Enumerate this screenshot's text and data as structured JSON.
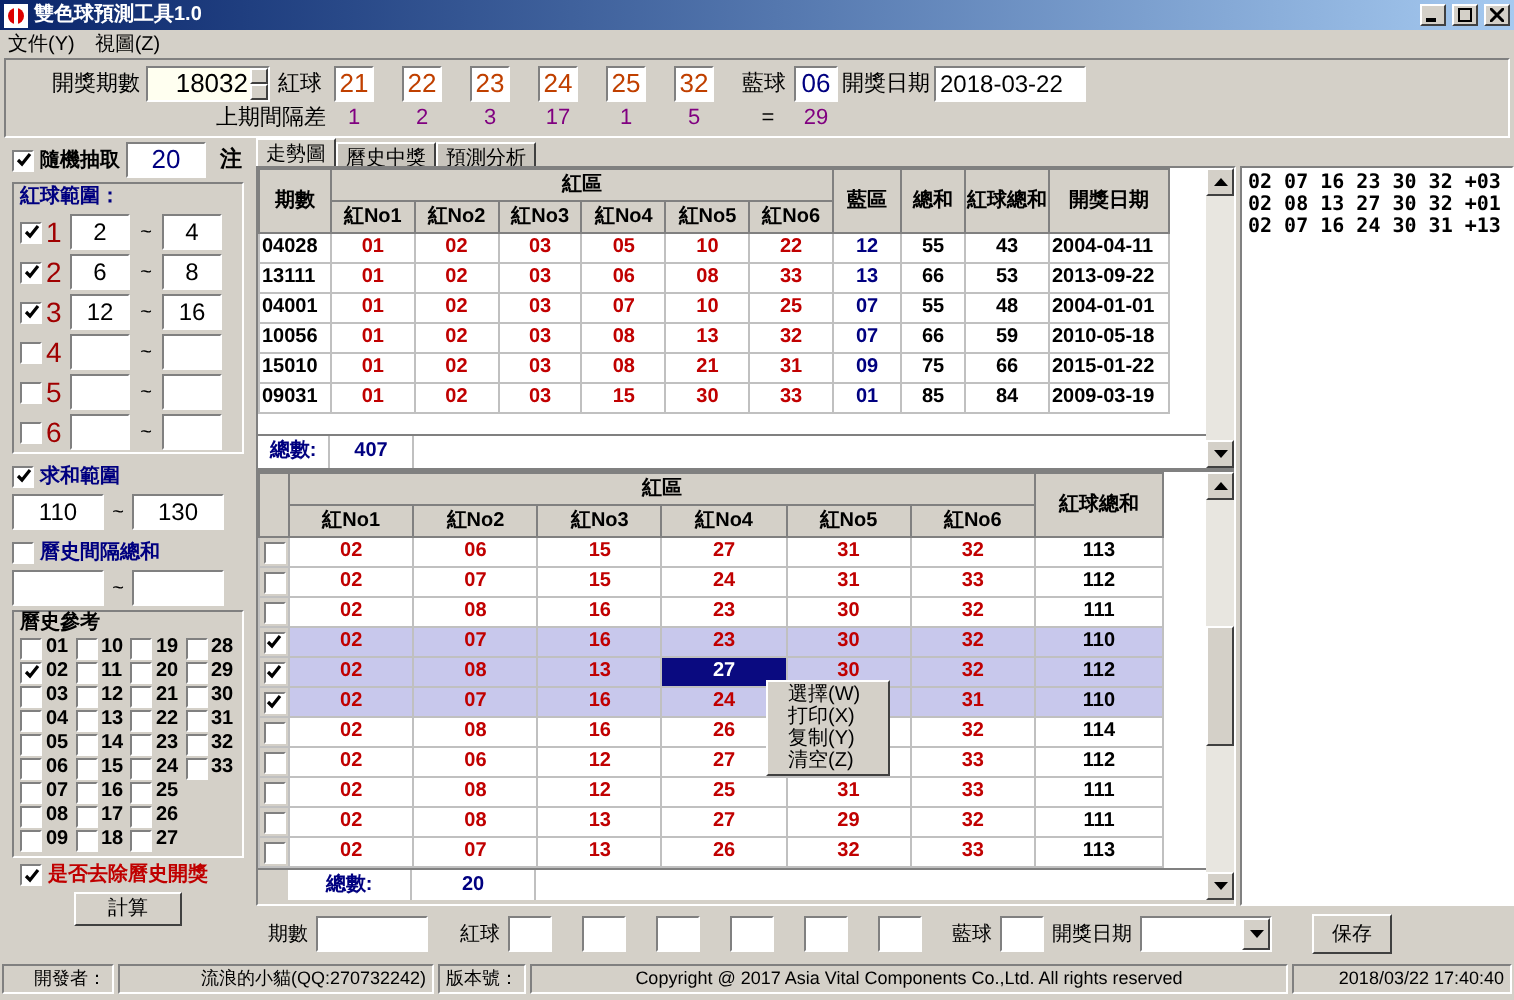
{
  "window": {
    "title": "雙色球預測工具1.0"
  },
  "menu": [
    "文件(Y)",
    "視圖(Z)"
  ],
  "draw": {
    "issue_label": "開獎期數",
    "issue": "18032",
    "red_label": "紅球",
    "reds": [
      "21",
      "22",
      "23",
      "24",
      "25",
      "32"
    ],
    "blue_label": "藍球",
    "blue": "06",
    "date_label": "開獎日期",
    "date": "2018-03-22",
    "gap_label": "上期間隔差",
    "gaps": [
      "1",
      "2",
      "3",
      "17",
      "1",
      "5"
    ],
    "eq": "=",
    "blue_gap": "29"
  },
  "left": {
    "random": {
      "checked": true,
      "label": "隨機抽取",
      "count": "20",
      "unit": "注"
    },
    "red_range": {
      "title": "紅球範圍：",
      "rows": [
        {
          "checked": true,
          "label": "1",
          "from": "2",
          "sep": "~",
          "to": "4"
        },
        {
          "checked": true,
          "label": "2",
          "from": "6",
          "sep": "~",
          "to": "8"
        },
        {
          "checked": true,
          "label": "3",
          "from": "12",
          "sep": "~",
          "to": "16"
        },
        {
          "checked": false,
          "label": "4",
          "sep": "~"
        },
        {
          "checked": false,
          "label": "5",
          "sep": "~"
        },
        {
          "checked": false,
          "label": "6",
          "sep": "~"
        }
      ]
    },
    "sum_range": {
      "checked": true,
      "label": "求和範圍",
      "from": "110",
      "sep": "~",
      "to": "130"
    },
    "hist_gap": {
      "checked": false,
      "label": "曆史間隔總和",
      "sep": "~"
    },
    "history": {
      "title": "曆史參考",
      "items": [
        {
          "label": "01",
          "checked": false
        },
        {
          "label": "02",
          "checked": true
        },
        {
          "label": "03",
          "checked": false
        },
        {
          "label": "04",
          "checked": false
        },
        {
          "label": "05",
          "checked": false
        },
        {
          "label": "06",
          "checked": false
        },
        {
          "label": "07",
          "checked": false
        },
        {
          "label": "08",
          "checked": false
        },
        {
          "label": "09",
          "checked": false
        },
        {
          "label": "10",
          "checked": false
        },
        {
          "label": "11",
          "checked": false
        },
        {
          "label": "12",
          "checked": false
        },
        {
          "label": "13",
          "checked": false
        },
        {
          "label": "14",
          "checked": false
        },
        {
          "label": "15",
          "checked": false
        },
        {
          "label": "16",
          "checked": false
        },
        {
          "label": "17",
          "checked": false
        },
        {
          "label": "18",
          "checked": false
        },
        {
          "label": "19",
          "checked": false
        },
        {
          "label": "20",
          "checked": false
        },
        {
          "label": "21",
          "checked": false
        },
        {
          "label": "22",
          "checked": false
        },
        {
          "label": "23",
          "checked": false
        },
        {
          "label": "24",
          "checked": false
        },
        {
          "label": "25",
          "checked": false
        },
        {
          "label": "26",
          "checked": false
        },
        {
          "label": "27",
          "checked": false
        },
        {
          "label": "28",
          "checked": false
        },
        {
          "label": "29",
          "checked": false
        },
        {
          "label": "30",
          "checked": false
        },
        {
          "label": "31",
          "checked": false
        },
        {
          "label": "32",
          "checked": false
        },
        {
          "label": "33",
          "checked": false
        }
      ]
    },
    "exclude": {
      "checked": true,
      "label": "是否去除曆史開獎"
    },
    "calc_button": "計算"
  },
  "tabs": [
    {
      "label": "走勢圖",
      "selected": true
    },
    {
      "label": "曆史中獎",
      "selected": false
    },
    {
      "label": "預測分析",
      "selected": false
    }
  ],
  "upper_table": {
    "columns": [
      "期數",
      "紅No1",
      "紅No2",
      "紅No3",
      "紅No4",
      "紅No5",
      "紅No6",
      "藍區",
      "總和",
      "紅球總和",
      "開獎日期"
    ],
    "group": "紅區",
    "rows": [
      [
        "04028",
        "01",
        "02",
        "03",
        "05",
        "10",
        "22",
        "12",
        "55",
        "43",
        "2004-04-11"
      ],
      [
        "13111",
        "01",
        "02",
        "03",
        "06",
        "08",
        "33",
        "13",
        "66",
        "53",
        "2013-09-22"
      ],
      [
        "04001",
        "01",
        "02",
        "03",
        "07",
        "10",
        "25",
        "07",
        "55",
        "48",
        "2004-01-01"
      ],
      [
        "10056",
        "01",
        "02",
        "03",
        "08",
        "13",
        "32",
        "07",
        "66",
        "59",
        "2010-05-18"
      ],
      [
        "15010",
        "01",
        "02",
        "03",
        "08",
        "21",
        "31",
        "09",
        "75",
        "66",
        "2015-01-22"
      ],
      [
        "09031",
        "01",
        "02",
        "03",
        "15",
        "30",
        "33",
        "01",
        "85",
        "84",
        "2009-03-19"
      ]
    ],
    "total_label": "總數:",
    "total": "407"
  },
  "lower_table": {
    "group": "紅區",
    "columns": [
      "紅No1",
      "紅No2",
      "紅No3",
      "紅No4",
      "紅No5",
      "紅No6"
    ],
    "sum_column": "紅球總和",
    "rows": [
      {
        "checked": false,
        "selected": false,
        "cells": [
          {
            "value": "02",
            "focused": false
          },
          {
            "value": "06",
            "focused": false
          },
          {
            "value": "15",
            "focused": false
          },
          {
            "value": "27",
            "focused": false
          },
          {
            "value": "31",
            "focused": false
          },
          {
            "value": "32",
            "focused": false
          }
        ],
        "sum": "113"
      },
      {
        "checked": false,
        "selected": false,
        "cells": [
          {
            "value": "02",
            "focused": false
          },
          {
            "value": "07",
            "focused": false
          },
          {
            "value": "15",
            "focused": false
          },
          {
            "value": "24",
            "focused": false
          },
          {
            "value": "31",
            "focused": false
          },
          {
            "value": "33",
            "focused": false
          }
        ],
        "sum": "112"
      },
      {
        "checked": false,
        "selected": false,
        "cells": [
          {
            "value": "02",
            "focused": false
          },
          {
            "value": "08",
            "focused": false
          },
          {
            "value": "16",
            "focused": false
          },
          {
            "value": "23",
            "focused": false
          },
          {
            "value": "30",
            "focused": false
          },
          {
            "value": "32",
            "focused": false
          }
        ],
        "sum": "111"
      },
      {
        "checked": true,
        "selected": true,
        "cells": [
          {
            "value": "02",
            "focused": false
          },
          {
            "value": "07",
            "focused": false
          },
          {
            "value": "16",
            "focused": false
          },
          {
            "value": "23",
            "focused": false
          },
          {
            "value": "30",
            "focused": false
          },
          {
            "value": "32",
            "focused": false
          }
        ],
        "sum": "110"
      },
      {
        "checked": true,
        "selected": true,
        "cells": [
          {
            "value": "02",
            "focused": false
          },
          {
            "value": "08",
            "focused": false
          },
          {
            "value": "13",
            "focused": false
          },
          {
            "value": "27",
            "focused": true
          },
          {
            "value": "30",
            "focused": false
          },
          {
            "value": "32",
            "focused": false
          }
        ],
        "sum": "112"
      },
      {
        "checked": true,
        "selected": true,
        "cells": [
          {
            "value": "02",
            "focused": false
          },
          {
            "value": "07",
            "focused": false
          },
          {
            "value": "16",
            "focused": false
          },
          {
            "value": "24",
            "focused": false
          },
          {
            "focused": false
          },
          {
            "value": "31",
            "focused": false
          }
        ],
        "sum": "110"
      },
      {
        "checked": false,
        "selected": false,
        "cells": [
          {
            "value": "02",
            "focused": false
          },
          {
            "value": "08",
            "focused": false
          },
          {
            "value": "16",
            "focused": false
          },
          {
            "value": "26",
            "focused": false
          },
          {
            "focused": false
          },
          {
            "value": "32",
            "focused": false
          }
        ],
        "sum": "114"
      },
      {
        "checked": false,
        "selected": false,
        "cells": [
          {
            "value": "02",
            "focused": false
          },
          {
            "value": "06",
            "focused": false
          },
          {
            "value": "12",
            "focused": false
          },
          {
            "value": "27",
            "focused": false
          },
          {
            "focused": false
          },
          {
            "value": "33",
            "focused": false
          }
        ],
        "sum": "112"
      },
      {
        "checked": false,
        "selected": false,
        "cells": [
          {
            "value": "02",
            "focused": false
          },
          {
            "value": "08",
            "focused": false
          },
          {
            "value": "12",
            "focused": false
          },
          {
            "value": "25",
            "focused": false
          },
          {
            "value": "31",
            "focused": false
          },
          {
            "value": "33",
            "focused": false
          }
        ],
        "sum": "111"
      },
      {
        "checked": false,
        "selected": false,
        "cells": [
          {
            "value": "02",
            "focused": false
          },
          {
            "value": "08",
            "focused": false
          },
          {
            "value": "13",
            "focused": false
          },
          {
            "value": "27",
            "focused": false
          },
          {
            "value": "29",
            "focused": false
          },
          {
            "value": "32",
            "focused": false
          }
        ],
        "sum": "111"
      },
      {
        "checked": false,
        "selected": false,
        "cells": [
          {
            "value": "02",
            "focused": false
          },
          {
            "value": "07",
            "focused": false
          },
          {
            "value": "13",
            "focused": false
          },
          {
            "value": "26",
            "focused": false
          },
          {
            "value": "32",
            "focused": false
          },
          {
            "value": "33",
            "focused": false
          }
        ],
        "sum": "113"
      }
    ],
    "total_label": "總數:",
    "total": "20"
  },
  "context_menu": [
    "選擇(W)",
    "打印(X)",
    "复制(Y)",
    "清空(Z)"
  ],
  "result_list": [
    "02 07 16 23 30 32 +03",
    "02 08 13 27 30 32 +01",
    "02 07 16 24 30 31 +13"
  ],
  "entry": {
    "issue_label": "期數",
    "red_label": "紅球",
    "blue_label": "藍球",
    "date_label": "開獎日期",
    "save_button": "保存"
  },
  "status_bar": [
    "開發者：",
    "流浪的小貓(QQ:270732242)",
    "版本號：",
    "Copyright @ 2017 Asia Vital Components Co.,Ltd. All rights reserved",
    "2018/03/22 17:40:40"
  ]
}
